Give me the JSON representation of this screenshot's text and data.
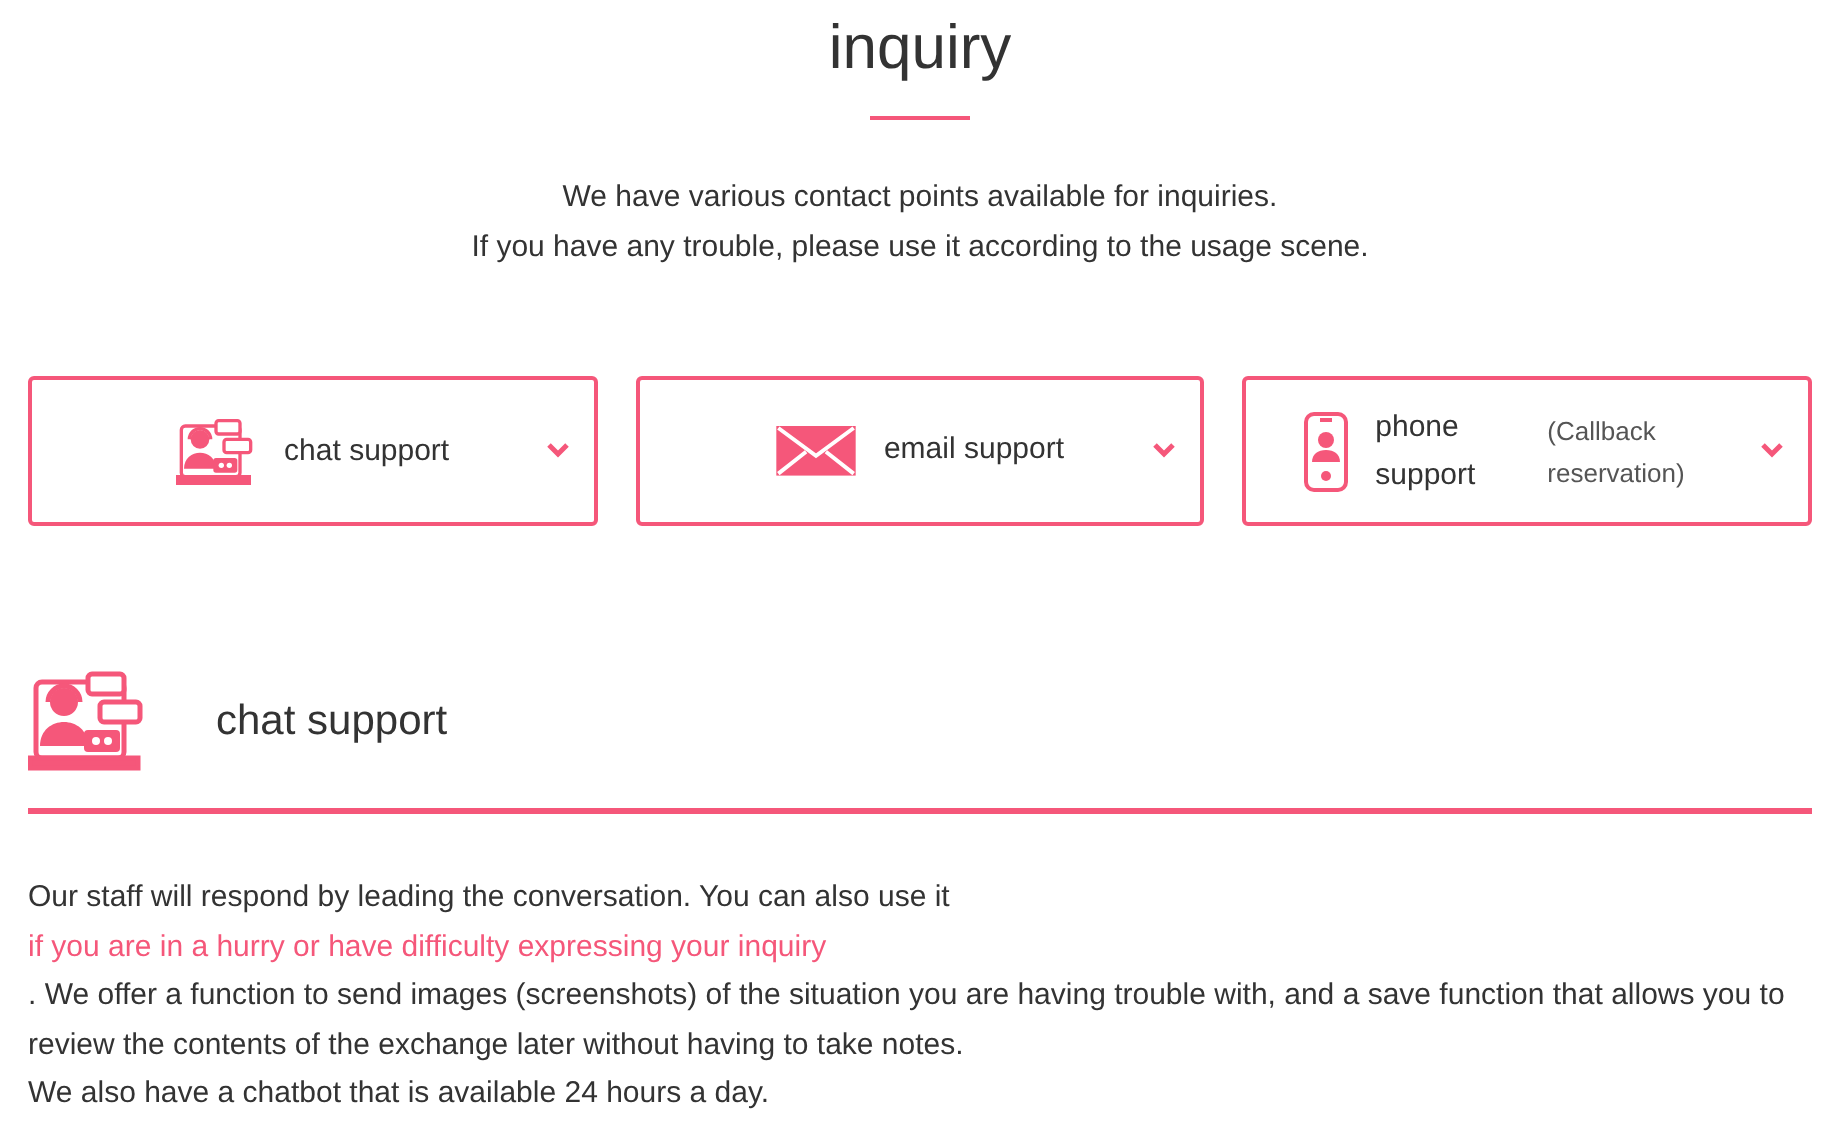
{
  "title": "inquiry",
  "intro": [
    "We have various contact points available for inquiries.",
    "If you have any trouble, please use it according to the usage scene."
  ],
  "cards": [
    {
      "kind": "chat",
      "label": "chat support"
    },
    {
      "kind": "email",
      "label": "email support"
    },
    {
      "kind": "phone",
      "label": "phone support",
      "note": "(Callback reservation)"
    }
  ],
  "section": {
    "kind": "chat",
    "heading": "chat support",
    "body": [
      {
        "kind": "text",
        "text": "Our staff will respond by leading the conversation. You can also use it"
      },
      {
        "kind": "highlight",
        "text": "if you are in a hurry or have difficulty expressing your inquiry"
      },
      {
        "kind": "text",
        "text": ". We offer a function to send images (screenshots) of the situation you are having trouble with, and a save function that allows you to review the contents of the exchange later without having to take notes."
      },
      {
        "kind": "text",
        "text": "We also have a chatbot that is available 24 hours a day."
      }
    ]
  }
}
